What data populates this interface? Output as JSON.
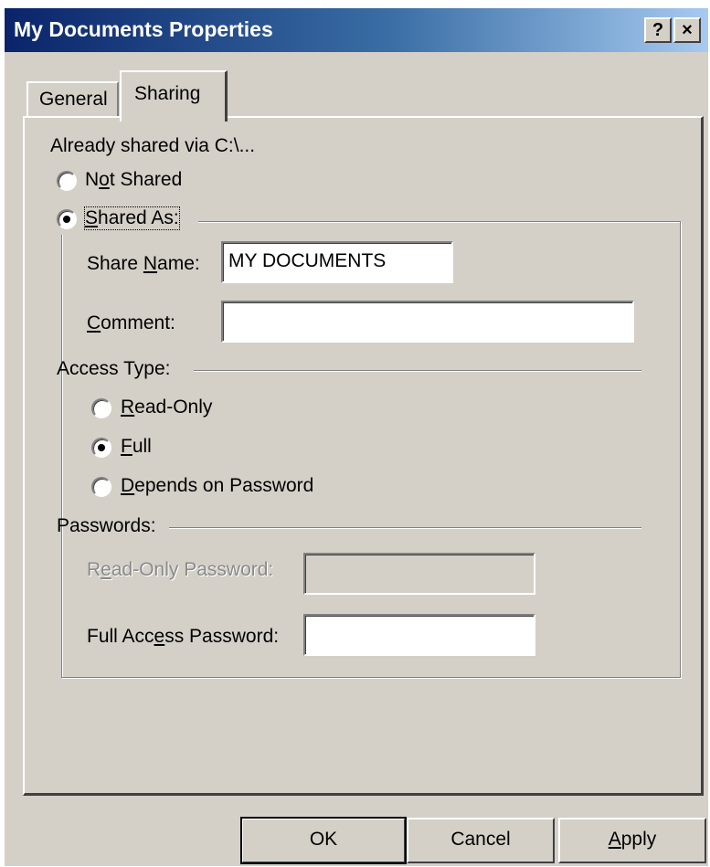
{
  "window": {
    "title": "My Documents Properties",
    "help_glyph": "?",
    "close_glyph": "×"
  },
  "tabs": {
    "general": "General",
    "sharing": "Sharing",
    "active": "Sharing"
  },
  "sharing": {
    "already_shared": "Already shared via C:\\...",
    "not_shared": {
      "pre": "N",
      "accel": "o",
      "post": "t Shared",
      "checked": false
    },
    "shared_as": {
      "accel": "S",
      "post": "hared As:",
      "checked": true
    },
    "share_name": {
      "pre": "Share ",
      "accel": "N",
      "post": "ame:",
      "value": "MY DOCUMENTS"
    },
    "comment": {
      "accel": "C",
      "post": "omment:",
      "value": ""
    },
    "access_type_label": "Access Type:",
    "access": [
      {
        "accel": "R",
        "post": "ead-Only",
        "checked": false
      },
      {
        "accel": "F",
        "post": "ull",
        "checked": true
      },
      {
        "accel": "D",
        "post": "epends on Password",
        "checked": false
      }
    ],
    "passwords_label": "Passwords:",
    "read_only_password": {
      "pre": "R",
      "accel": "e",
      "post": "ad-Only Password:",
      "value": "",
      "disabled": true
    },
    "full_access_password": {
      "pre": "Full Acc",
      "accel": "e",
      "post": "ss Password:",
      "value": "",
      "disabled": false
    }
  },
  "buttons": {
    "ok": "OK",
    "cancel": "Cancel",
    "apply": {
      "accel": "A",
      "post": "pply"
    }
  },
  "colors": {
    "dialog_face": "#d4d0c8",
    "title_start": "#0a246a",
    "title_end": "#a6caf0"
  }
}
